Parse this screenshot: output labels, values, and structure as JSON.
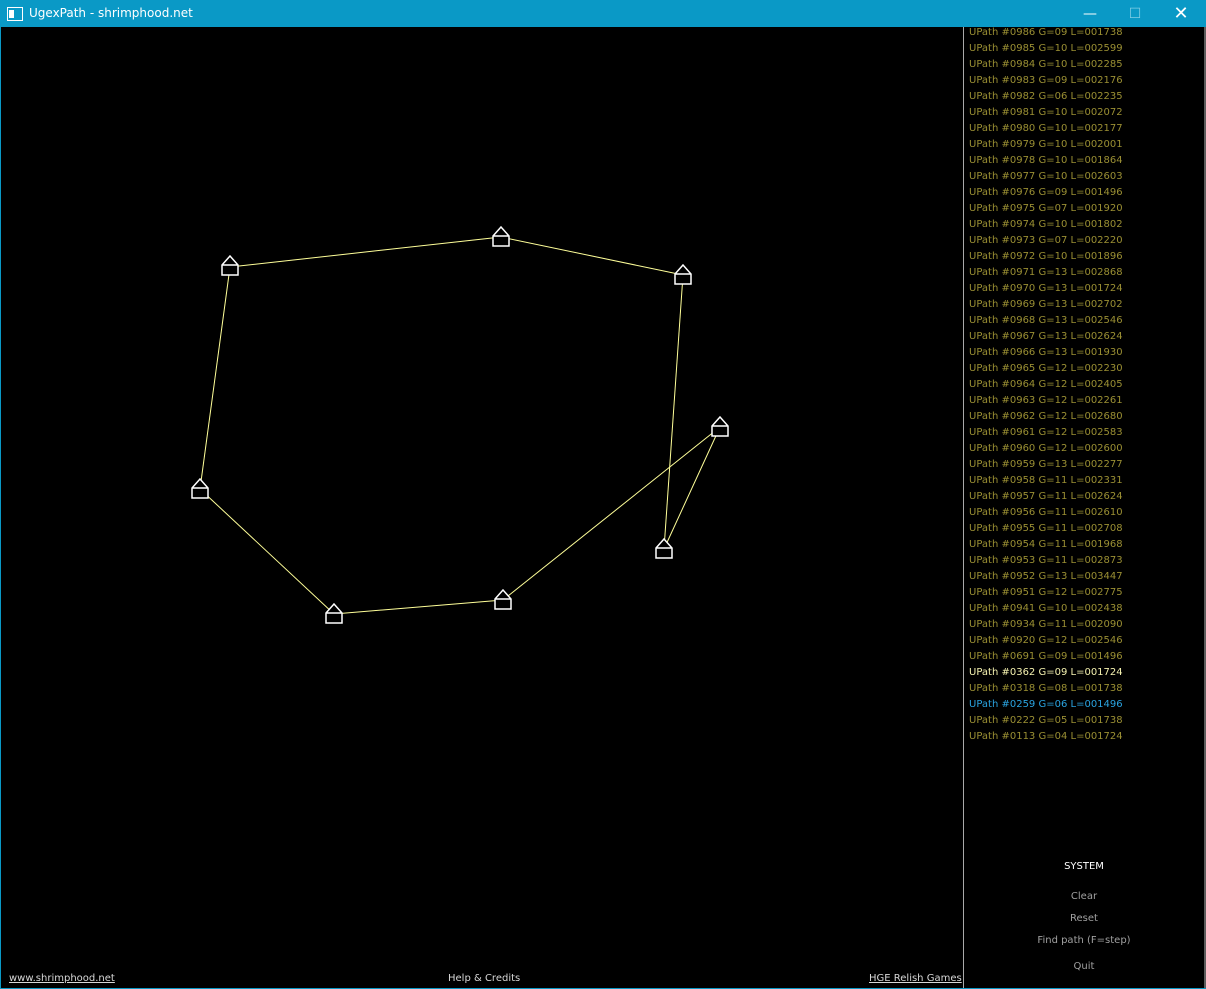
{
  "window": {
    "title": "UgexPath - shrimphood.net",
    "minimize": "—",
    "maximize": "☐",
    "close": "✕"
  },
  "colors": {
    "titlebar": "#0a99c6",
    "path_line": "#ffff99",
    "node": "#ffffff",
    "list_normal": "#9a8f33",
    "list_selected": "#f5f2b0",
    "list_best": "#2aa3e0"
  },
  "paths": [
    {
      "label": "UPath #0986 G=09 L=001738"
    },
    {
      "label": "UPath #0985 G=10 L=002599"
    },
    {
      "label": "UPath #0984 G=10 L=002285"
    },
    {
      "label": "UPath #0983 G=09 L=002176"
    },
    {
      "label": "UPath #0982 G=06 L=002235"
    },
    {
      "label": "UPath #0981 G=10 L=002072"
    },
    {
      "label": "UPath #0980 G=10 L=002177"
    },
    {
      "label": "UPath #0979 G=10 L=002001"
    },
    {
      "label": "UPath #0978 G=10 L=001864"
    },
    {
      "label": "UPath #0977 G=10 L=002603"
    },
    {
      "label": "UPath #0976 G=09 L=001496"
    },
    {
      "label": "UPath #0975 G=07 L=001920"
    },
    {
      "label": "UPath #0974 G=10 L=001802"
    },
    {
      "label": "UPath #0973 G=07 L=002220"
    },
    {
      "label": "UPath #0972 G=10 L=001896"
    },
    {
      "label": "UPath #0971 G=13 L=002868"
    },
    {
      "label": "UPath #0970 G=13 L=001724"
    },
    {
      "label": "UPath #0969 G=13 L=002702"
    },
    {
      "label": "UPath #0968 G=13 L=002546"
    },
    {
      "label": "UPath #0967 G=13 L=002624"
    },
    {
      "label": "UPath #0966 G=13 L=001930"
    },
    {
      "label": "UPath #0965 G=12 L=002230"
    },
    {
      "label": "UPath #0964 G=12 L=002405"
    },
    {
      "label": "UPath #0963 G=12 L=002261"
    },
    {
      "label": "UPath #0962 G=12 L=002680"
    },
    {
      "label": "UPath #0961 G=12 L=002583"
    },
    {
      "label": "UPath #0960 G=12 L=002600"
    },
    {
      "label": "UPath #0959 G=13 L=002277"
    },
    {
      "label": "UPath #0958 G=11 L=002331"
    },
    {
      "label": "UPath #0957 G=11 L=002624"
    },
    {
      "label": "UPath #0956 G=11 L=002610"
    },
    {
      "label": "UPath #0955 G=11 L=002708"
    },
    {
      "label": "UPath #0954 G=11 L=001968"
    },
    {
      "label": "UPath #0953 G=11 L=002873"
    },
    {
      "label": "UPath #0952 G=13 L=003447"
    },
    {
      "label": "UPath #0951 G=12 L=002775"
    },
    {
      "label": "UPath #0941 G=10 L=002438"
    },
    {
      "label": "UPath #0934 G=11 L=002090"
    },
    {
      "label": "UPath #0920 G=12 L=002546"
    },
    {
      "label": "UPath #0691 G=09 L=001496"
    },
    {
      "label": "UPath #0362 G=09 L=001724",
      "state": "selected"
    },
    {
      "label": "UPath #0318 G=08 L=001738"
    },
    {
      "label": "UPath #0259 G=06 L=001496",
      "state": "best"
    },
    {
      "label": "UPath #0222 G=05 L=001738"
    },
    {
      "label": "UPath #0113 G=04 L=001724"
    }
  ],
  "system_menu": {
    "heading": "SYSTEM",
    "clear": "Clear",
    "reset": "Reset",
    "find_path": "Find path (F=step)",
    "quit": "Quit"
  },
  "footer": {
    "left_link": "www.shrimphood.net",
    "help": "Help & Credits",
    "right_link": "HGE Relish Games"
  },
  "graph_icons": {
    "node": "house-node-icon"
  }
}
